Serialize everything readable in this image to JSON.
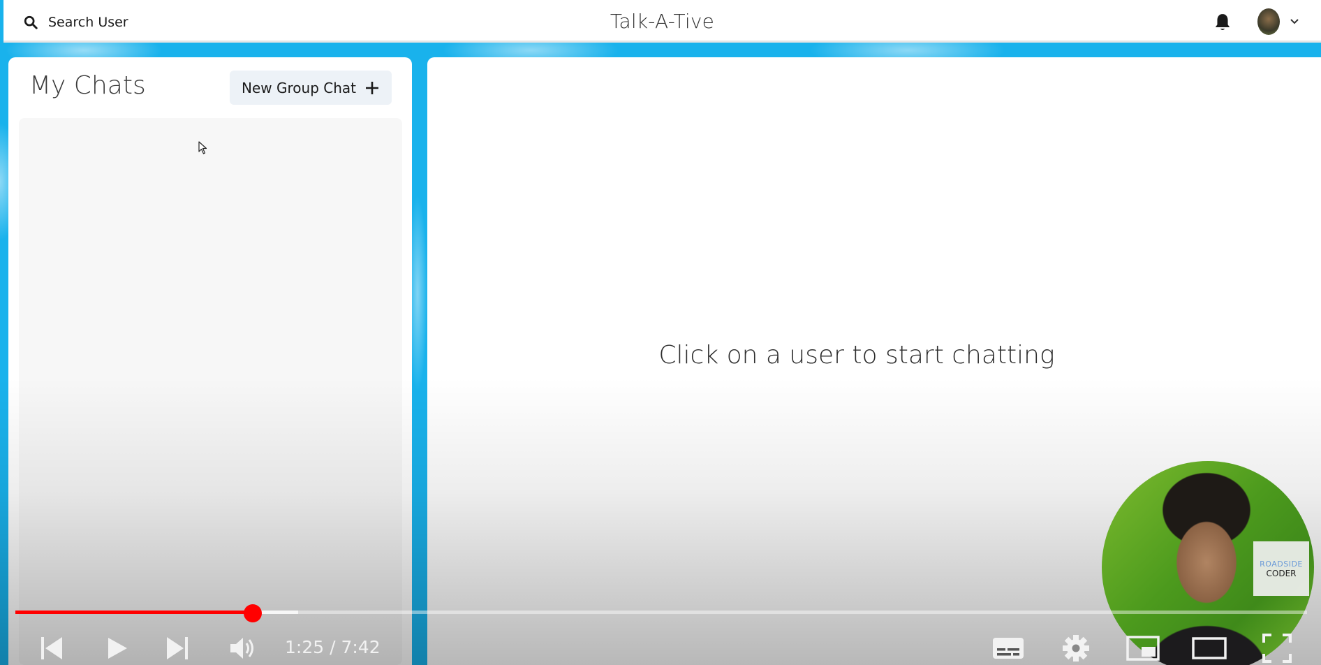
{
  "header": {
    "search_label": "Search User",
    "app_title": "Talk-A-Tive",
    "icons": [
      "search-icon",
      "bell-icon",
      "avatar",
      "chevron-down-icon"
    ]
  },
  "sidebar": {
    "title": "My Chats",
    "new_group_label": "New Group Chat",
    "new_group_icon": "plus-icon"
  },
  "main": {
    "empty_message": "Click on a user to start chatting"
  },
  "video_player": {
    "current_time": "1:25",
    "duration": "7:42",
    "time_display": "1:25 / 7:42",
    "progress_fraction": 0.184,
    "buffered_fraction": 0.219,
    "progress_color": "#ff0000",
    "webcam_badge_top": "ROADSIDE",
    "webcam_badge_bottom": "CODER",
    "controls": [
      "previous-icon",
      "play-icon",
      "next-icon",
      "volume-icon",
      "subtitles-icon",
      "settings-icon",
      "miniplayer-icon",
      "theater-icon",
      "fullscreen-icon"
    ]
  },
  "colors": {
    "background": "#19b2ec",
    "panel": "#ffffff",
    "chat_list_bg": "#f7f7f7",
    "button_bg": "#edf2f7"
  }
}
